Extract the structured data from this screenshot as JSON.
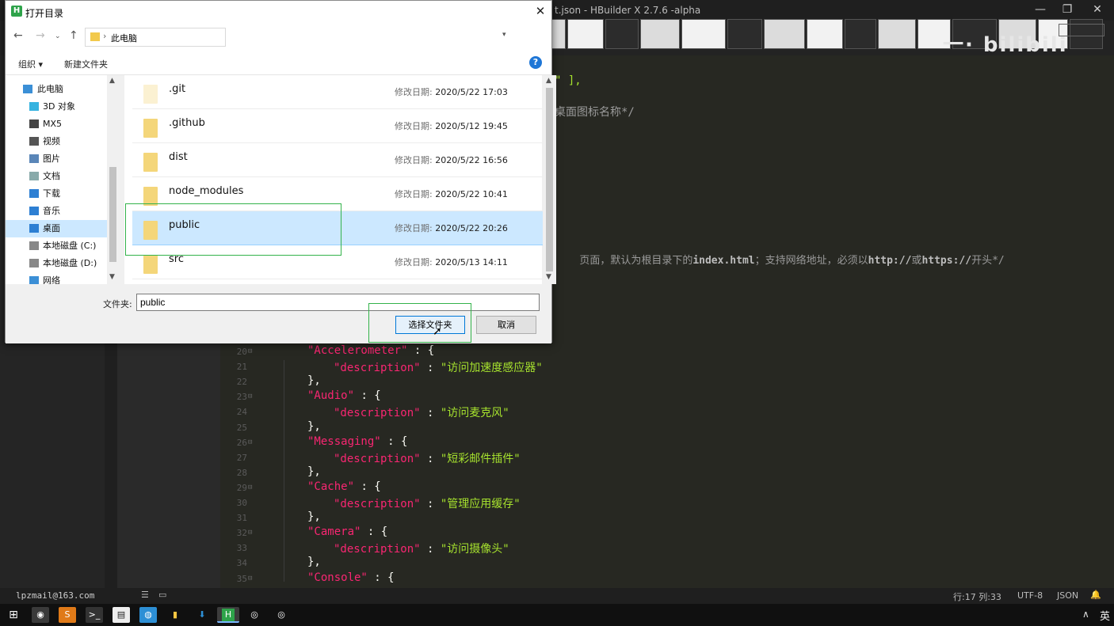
{
  "editor": {
    "title": "t.json - HBuilder X 2.7.6 -alpha",
    "logo_text": "一· bilibili",
    "visible_fragments": {
      "line1": "\" ],",
      "line2": "桌面图标名称*/",
      "line3_a": "页面，默认为根目录下的",
      "line3_b": "index.html",
      "line3_c": "；支持网络地址，必须以",
      "line3_d": "http://",
      "line3_e": "或",
      "line3_f": "https://",
      "line3_g": "开头*/"
    },
    "code_lines": [
      {
        "num": "20",
        "fold": true,
        "indent": 0,
        "key": "\"Accelerometer\"",
        "tail": " : {"
      },
      {
        "num": "21",
        "fold": false,
        "indent": 1,
        "key": "\"description\"",
        "tail_sep": " : ",
        "val": "\"访问加速度感应器\""
      },
      {
        "num": "22",
        "fold": false,
        "indent": 0,
        "plain": "},"
      },
      {
        "num": "23",
        "fold": true,
        "indent": 0,
        "key": "\"Audio\"",
        "tail": " : {"
      },
      {
        "num": "24",
        "fold": false,
        "indent": 1,
        "key": "\"description\"",
        "tail_sep": " : ",
        "val": "\"访问麦克风\""
      },
      {
        "num": "25",
        "fold": false,
        "indent": 0,
        "plain": "},"
      },
      {
        "num": "26",
        "fold": true,
        "indent": 0,
        "key": "\"Messaging\"",
        "tail": " : {"
      },
      {
        "num": "27",
        "fold": false,
        "indent": 1,
        "key": "\"description\"",
        "tail_sep": " : ",
        "val": "\"短彩邮件插件\""
      },
      {
        "num": "28",
        "fold": false,
        "indent": 0,
        "plain": "},"
      },
      {
        "num": "29",
        "fold": true,
        "indent": 0,
        "key": "\"Cache\"",
        "tail": " : {"
      },
      {
        "num": "30",
        "fold": false,
        "indent": 1,
        "key": "\"description\"",
        "tail_sep": " : ",
        "val": "\"管理应用缓存\""
      },
      {
        "num": "31",
        "fold": false,
        "indent": 0,
        "plain": "},"
      },
      {
        "num": "32",
        "fold": true,
        "indent": 0,
        "key": "\"Camera\"",
        "tail": " : {"
      },
      {
        "num": "33",
        "fold": false,
        "indent": 1,
        "key": "\"description\"",
        "tail_sep": " : ",
        "val": "\"访问摄像头\""
      },
      {
        "num": "34",
        "fold": false,
        "indent": 0,
        "plain": "},"
      },
      {
        "num": "35",
        "fold": true,
        "indent": 0,
        "key": "\"Console\"",
        "tail": " : {"
      }
    ],
    "status": {
      "user": "lpzmail@163.com",
      "position": "行:17  列:33",
      "encoding": "UTF-8",
      "language": "JSON"
    }
  },
  "taskbar": {
    "ime": "英",
    "tray_chevron": "∧",
    "volume": "◂)"
  },
  "dialog": {
    "title": "打开目录",
    "app_icon_letter": "H",
    "close_glyph": "✕",
    "address": "此电脑",
    "toolbar": {
      "organize": "组织 ▾",
      "new_folder": "新建文件夹",
      "help": "?"
    },
    "nav_items": [
      {
        "label": "此电脑",
        "icon": "computer-icon"
      },
      {
        "label": "3D 对象",
        "icon": "3d-objects-icon"
      },
      {
        "label": "MX5",
        "icon": "phone-icon"
      },
      {
        "label": "视频",
        "icon": "video-icon"
      },
      {
        "label": "图片",
        "icon": "pictures-icon"
      },
      {
        "label": "文档",
        "icon": "documents-icon"
      },
      {
        "label": "下载",
        "icon": "download-icon"
      },
      {
        "label": "音乐",
        "icon": "music-icon"
      },
      {
        "label": "桌面",
        "icon": "desktop-icon",
        "selected": true
      },
      {
        "label": "本地磁盘 (C:)",
        "icon": "drive-icon"
      },
      {
        "label": "本地磁盘 (D:)",
        "icon": "drive-icon"
      },
      {
        "label": "网络",
        "icon": "network-icon"
      }
    ],
    "date_label": "修改日期:",
    "files": [
      {
        "name": ".git",
        "date": "2020/5/22 17:03"
      },
      {
        "name": ".github",
        "date": "2020/5/12 19:45"
      },
      {
        "name": "dist",
        "date": "2020/5/22 16:56"
      },
      {
        "name": "node_modules",
        "date": "2020/5/22 10:41"
      },
      {
        "name": "public",
        "date": "2020/5/22 20:26",
        "selected": true
      },
      {
        "name": "src",
        "date": "2020/5/13 14:11"
      }
    ],
    "folder_label": "文件夹:",
    "folder_value": "public",
    "select_button": "选择文件夹",
    "cancel_button": "取消"
  }
}
